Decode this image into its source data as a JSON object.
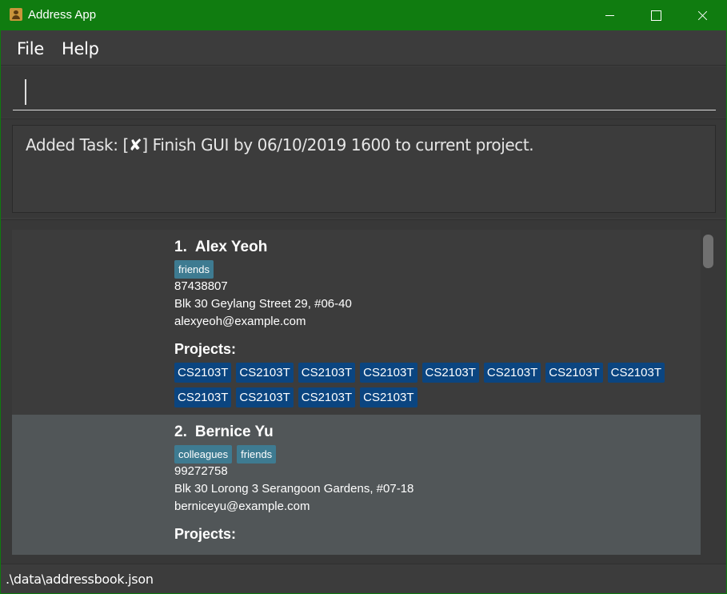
{
  "window": {
    "title": "Address App",
    "accent_color": "#107c10"
  },
  "menu": {
    "file": "File",
    "help": "Help"
  },
  "command": {
    "value": ""
  },
  "result": {
    "prefix": "Added Task: [",
    "check": "✘",
    "suffix": "] Finish GUI by 06/10/2019 1600 to current project."
  },
  "persons": [
    {
      "index": "1.",
      "name": "Alex Yeoh",
      "tags": [
        "friends"
      ],
      "phone": "87438807",
      "address": "Blk 30 Geylang Street 29, #06-40",
      "email": "alexyeoh@example.com",
      "projects_label": "Projects:",
      "projects": [
        "CS2103T",
        "CS2103T",
        "CS2103T",
        "CS2103T",
        "CS2103T",
        "CS2103T",
        "CS2103T",
        "CS2103T",
        "CS2103T",
        "CS2103T",
        "CS2103T",
        "CS2103T"
      ]
    },
    {
      "index": "2.",
      "name": "Bernice Yu",
      "tags": [
        "colleagues",
        "friends"
      ],
      "phone": "99272758",
      "address": "Blk 30 Lorong 3 Serangoon Gardens, #07-18",
      "email": "berniceyu@example.com",
      "projects_label": "Projects:",
      "projects": []
    }
  ],
  "status": {
    "path": ".\\data\\addressbook.json"
  }
}
